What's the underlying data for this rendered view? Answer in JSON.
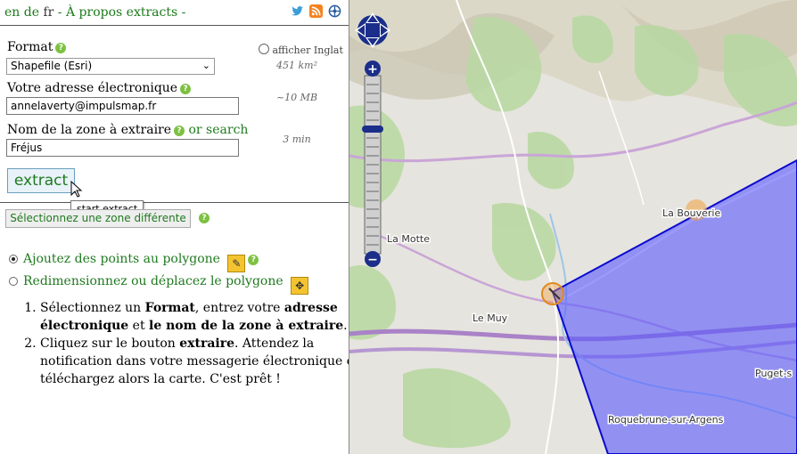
{
  "header": {
    "lang_en": "en",
    "lang_de": "de",
    "lang_fr": "fr",
    "separator": "-",
    "about": "À propos extracts",
    "trailing": "-"
  },
  "form": {
    "format_label": "Format",
    "format_value": "Shapefile (Esri)",
    "show_english": "afficher Inglat",
    "area": "451 km²",
    "email_label": "Votre adresse électronique",
    "email_value": "annelaverty@impulsmap.fr",
    "size": "~10 MB",
    "zone_label": "Nom de la zone à extraire",
    "or_search": "or search",
    "zone_value": "Fréjus",
    "time": "3 min",
    "extract_label": "extract",
    "tooltip": "start extract"
  },
  "polygon": {
    "zone_button": "Sélectionnez une zone différente",
    "add_points": "Ajoutez des points au polygone",
    "resize": "Redimensionnez ou déplacez le polygone"
  },
  "instructions": {
    "step1_a": "Sélectionnez un ",
    "step1_b": "Format",
    "step1_c": ", entrez votre ",
    "step1_d": "adresse électronique",
    "step1_e": " et ",
    "step1_f": "le nom de la zone à extraire",
    "step1_g": ".",
    "step2_a": "Cliquez sur le bouton ",
    "step2_b": "extraire",
    "step2_c": ". Attendez la notification dans votre messagerie électronique et téléchargez alors la carte. C'est prêt !"
  },
  "map": {
    "places": [
      "La Motte",
      "La Bouverie",
      "Le Muy",
      "Puget-s",
      "Roquebrune-sur-Argens"
    ],
    "polygon_color": "#5a5aff",
    "zoom_in": "+",
    "zoom_out": "−"
  },
  "colors": {
    "link_green": "#1f7a1f",
    "help_green": "#7dc142",
    "tool_yellow": "#f4c430"
  }
}
